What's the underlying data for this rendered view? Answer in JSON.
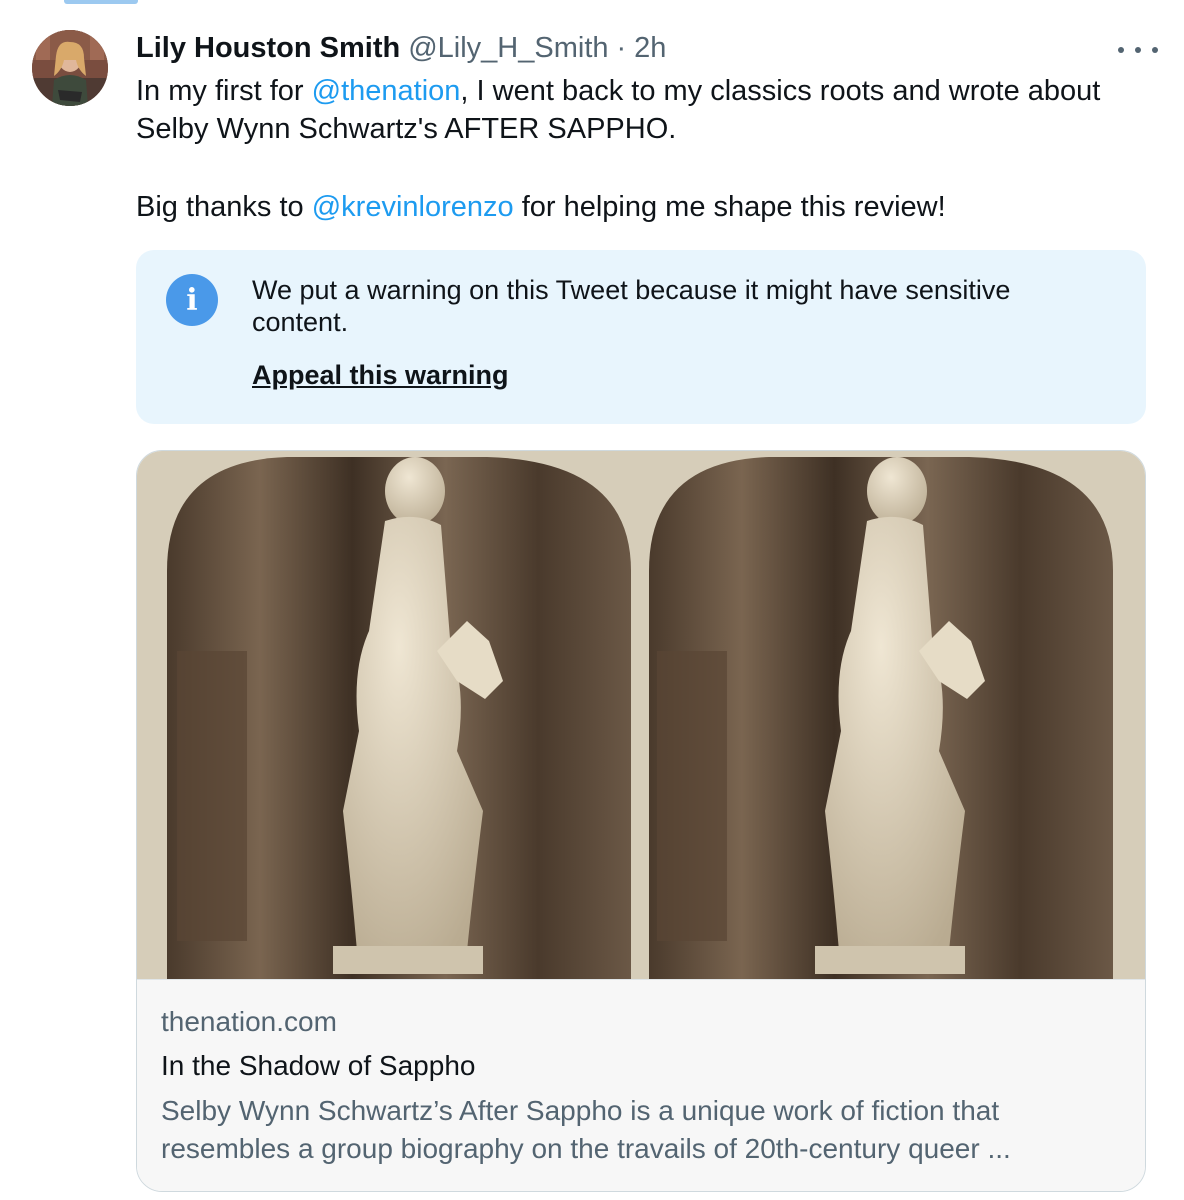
{
  "tweet": {
    "author_name": "Lily Houston Smith",
    "handle": "@Lily_H_Smith",
    "separator": "·",
    "time": "2h",
    "more_icon": "more-horizontal-icon",
    "text": {
      "line1_pre": "In my first for ",
      "mention1": "@thenation",
      "line1_post": ", I went back to my classics roots and wrote about Selby Wynn Schwartz's AFTER SAPPHO.",
      "line2_pre": "Big thanks to ",
      "mention2": "@krevinlorenzo",
      "line2_post": " for helping me shape this review!"
    },
    "mention_color": "#1d9bf0"
  },
  "warning": {
    "icon": "info-icon",
    "icon_glyph": "i",
    "message": "We put a warning on this Tweet because it might have sensitive content.",
    "appeal_label": "Appeal this warning",
    "background": "#e8f5fd"
  },
  "link_card": {
    "domain": "thenation.com",
    "title": "In the Shadow of Sappho",
    "description": "Selby Wynn Schwartz’s After Sappho is a unique work of fiction that resembles a group biography on the travails of 20th-century queer ..."
  }
}
